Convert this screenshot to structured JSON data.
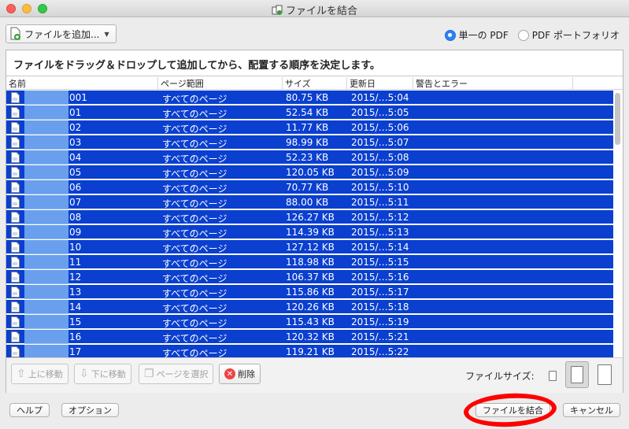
{
  "window": {
    "title": "ファイルを結合"
  },
  "toolbar": {
    "add_files_label": "ファイルを追加...",
    "radio_single": "単一の PDF",
    "radio_portfolio": "PDF ポートフォリオ",
    "selected_mode": "single"
  },
  "instruction": "ファイルをドラッグ＆ドロップして追加してから、配置する順序を決定します。",
  "table": {
    "columns": [
      "名前",
      "ページ範囲",
      "サイズ",
      "更新日",
      "警告とエラー"
    ],
    "rows": [
      {
        "name": "001",
        "range": "すべてのページ",
        "size": "80.75 KB",
        "date": "2015/…5:04"
      },
      {
        "name": "01",
        "range": "すべてのページ",
        "size": "52.54 KB",
        "date": "2015/…5:05"
      },
      {
        "name": "02",
        "range": "すべてのページ",
        "size": "11.77 KB",
        "date": "2015/…5:06"
      },
      {
        "name": "03",
        "range": "すべてのページ",
        "size": "98.99 KB",
        "date": "2015/…5:07"
      },
      {
        "name": "04",
        "range": "すべてのページ",
        "size": "52.23 KB",
        "date": "2015/…5:08"
      },
      {
        "name": "05",
        "range": "すべてのページ",
        "size": "120.05 KB",
        "date": "2015/…5:09"
      },
      {
        "name": "06",
        "range": "すべてのページ",
        "size": "70.77 KB",
        "date": "2015/…5:10"
      },
      {
        "name": "07",
        "range": "すべてのページ",
        "size": "88.00 KB",
        "date": "2015/…5:11"
      },
      {
        "name": "08",
        "range": "すべてのページ",
        "size": "126.27 KB",
        "date": "2015/…5:12"
      },
      {
        "name": "09",
        "range": "すべてのページ",
        "size": "114.39 KB",
        "date": "2015/…5:13"
      },
      {
        "name": "10",
        "range": "すべてのページ",
        "size": "127.12 KB",
        "date": "2015/…5:14"
      },
      {
        "name": "11",
        "range": "すべてのページ",
        "size": "118.98 KB",
        "date": "2015/…5:15"
      },
      {
        "name": "12",
        "range": "すべてのページ",
        "size": "106.37 KB",
        "date": "2015/…5:16"
      },
      {
        "name": "13",
        "range": "すべてのページ",
        "size": "115.86 KB",
        "date": "2015/…5:17"
      },
      {
        "name": "14",
        "range": "すべてのページ",
        "size": "120.26 KB",
        "date": "2015/…5:18"
      },
      {
        "name": "15",
        "range": "すべてのページ",
        "size": "115.43 KB",
        "date": "2015/…5:19"
      },
      {
        "name": "16",
        "range": "すべてのページ",
        "size": "120.32 KB",
        "date": "2015/…5:21"
      },
      {
        "name": "17",
        "range": "すべてのページ",
        "size": "119.21 KB",
        "date": "2015/…5:22"
      }
    ]
  },
  "actions": {
    "move_up": "上に移動",
    "move_down": "下に移動",
    "select_pages": "ページを選択",
    "delete": "削除",
    "file_size_label": "ファイルサイズ:"
  },
  "footer": {
    "help": "ヘルプ",
    "options": "オプション",
    "combine": "ファイルを結合",
    "cancel": "キャンセル"
  },
  "colors": {
    "selection": "#0a3fcf",
    "accent": "#2a83f4",
    "annotation": "#ff0000"
  }
}
